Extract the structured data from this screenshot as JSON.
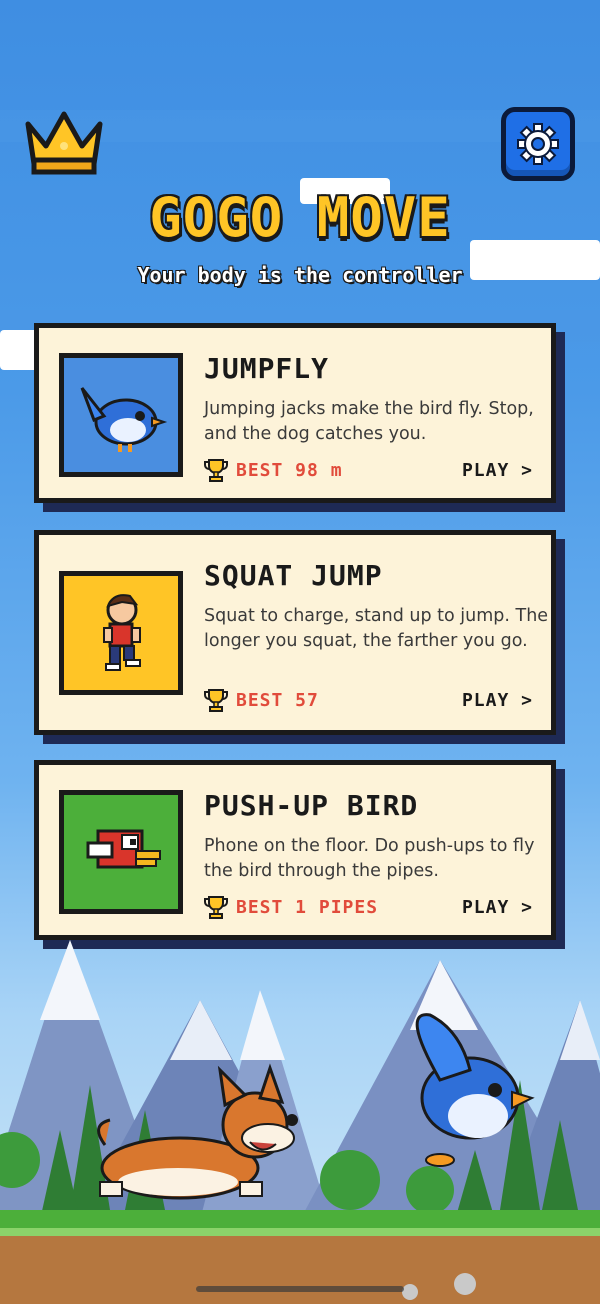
{
  "app": {
    "title": "GOGO MOVE",
    "subtitle": "Your body is the controller"
  },
  "header": {
    "left_icon": "crown-icon",
    "right_icon": "gear-icon"
  },
  "games": [
    {
      "title": "JUMPFLY",
      "description": "Jumping jacks make the bird fly. Stop, and the dog catches you.",
      "best": "BEST 98 m",
      "play": "PLAY >",
      "thumb_icon": "blue-bird-icon",
      "thumb_bg": "#4a8ee0"
    },
    {
      "title": "SQUAT JUMP",
      "description": "Squat to charge, stand up to jump. The longer you squat, the farther you go.",
      "best": "BEST 57",
      "play": "PLAY >",
      "thumb_icon": "running-boy-icon",
      "thumb_bg": "#ffc526"
    },
    {
      "title": "PUSH-UP BIRD",
      "description": "Phone on the floor. Do push-ups to fly the bird through the pipes.",
      "best": "BEST 1 PIPES",
      "play": "PLAY >",
      "thumb_icon": "red-flappy-bird-icon",
      "thumb_bg": "#4caf3a"
    }
  ],
  "colors": {
    "title_yellow": "#ffc526",
    "card_bg": "#fdf3d9",
    "best_red": "#e14b3b",
    "sky_blue": "#3f8ee2",
    "gear_button": "#1f6fe6"
  }
}
